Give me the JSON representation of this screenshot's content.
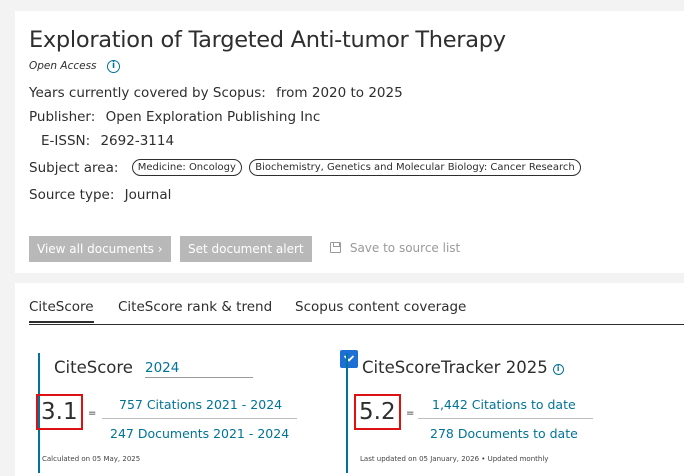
{
  "source": {
    "title": "Exploration of Targeted Anti-tumor Therapy",
    "access": "Open Access",
    "info_icon": "i",
    "coverage_label": "Years currently covered by Scopus:",
    "coverage_value": "from 2020 to 2025",
    "publisher_label": "Publisher:",
    "publisher_value": "Open Exploration Publishing Inc",
    "eissn_label": "E-ISSN:",
    "eissn_value": "2692-3114",
    "subject_label": "Subject area:",
    "subjects": [
      "Medicine: Oncology",
      "Biochemistry, Genetics and Molecular Biology: Cancer Research"
    ],
    "source_type_label": "Source type:",
    "source_type_value": "Journal"
  },
  "actions": {
    "view_all": "View all documents",
    "view_all_glyph": "›",
    "set_alert": "Set document alert",
    "save": "Save to source list"
  },
  "tabs": [
    "CiteScore",
    "CiteScore rank & trend",
    "Scopus content coverage"
  ],
  "citescore": {
    "label": "CiteScore",
    "year": "2024",
    "value": "3.1",
    "equals": "=",
    "citations": "757 Citations 2021 - 2024",
    "documents": "247 Documents 2021 - 2024",
    "footnote": "Calculated on 05 May, 2025"
  },
  "tracker": {
    "label": "CiteScoreTracker 2025",
    "info_icon": "i",
    "value": "5.2",
    "equals": "=",
    "citations": "1,442 Citations to date",
    "documents": "278 Documents to date",
    "footnote": "Last updated on 05 January, 2026 • Updated monthly"
  },
  "colors": {
    "link": "#007398",
    "highlight_box": "#dd1111",
    "dropdown_button": "#1d6fd6",
    "disabled_button": "#b8b8b8"
  }
}
